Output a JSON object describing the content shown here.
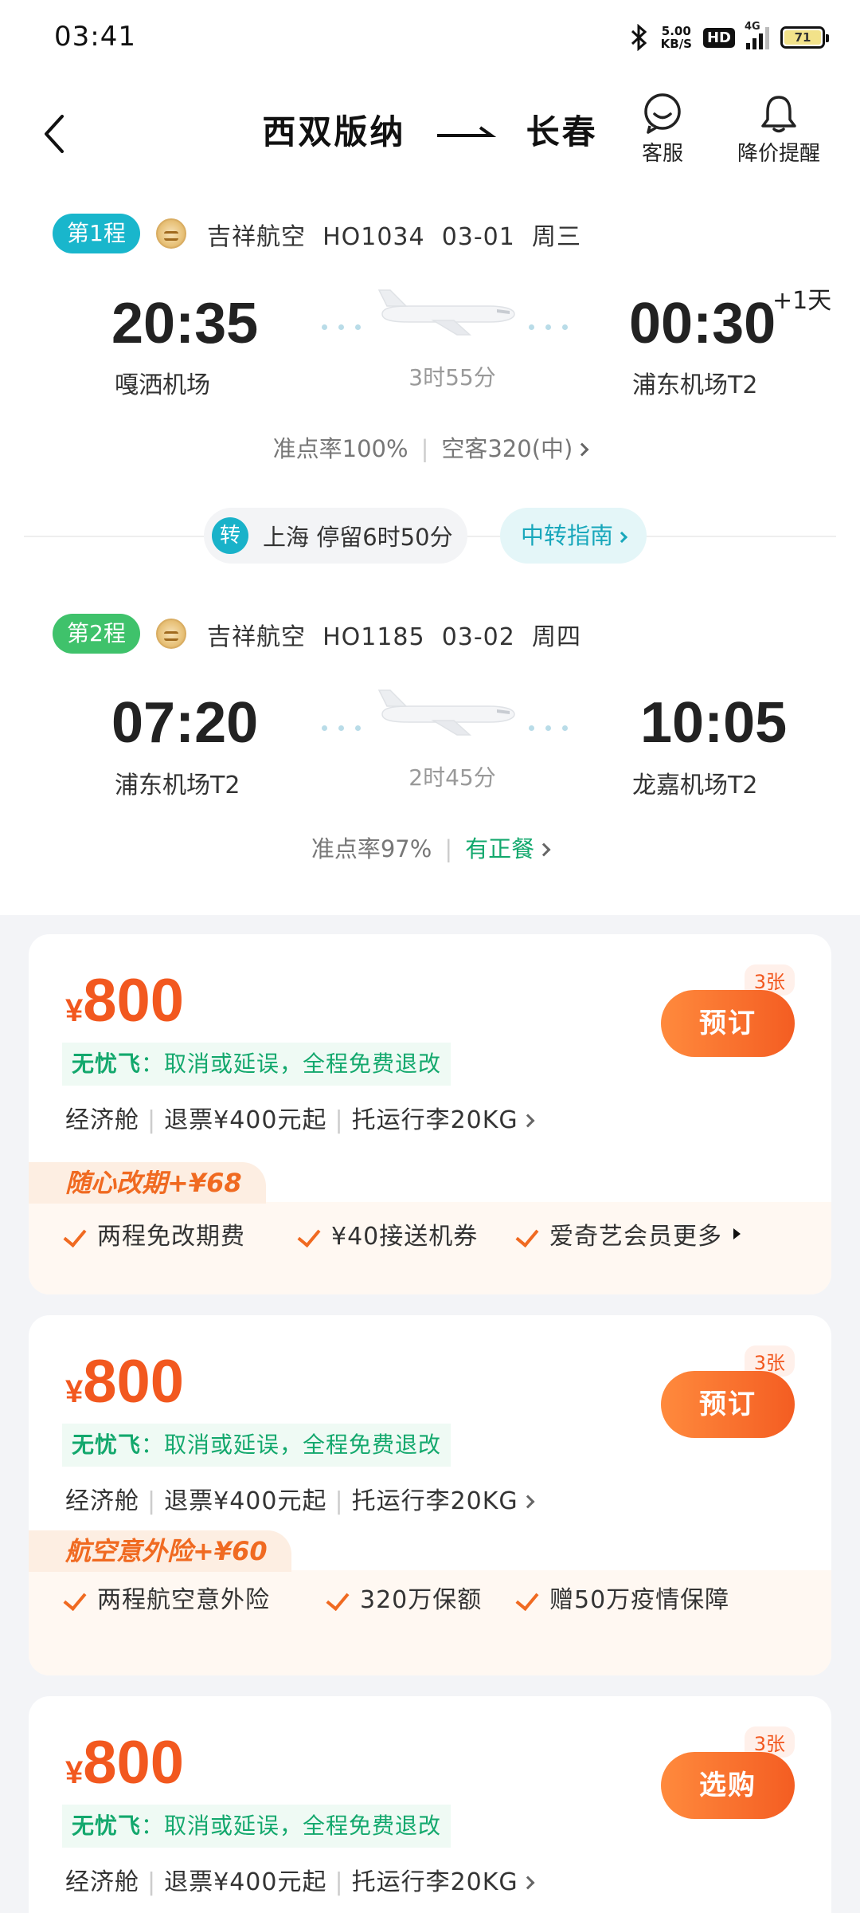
{
  "status_bar": {
    "time": "03:41",
    "net_speed": "5.00",
    "net_unit": "KB/S",
    "hd_label": "HD",
    "signal_label": "4G",
    "battery": "71"
  },
  "header": {
    "origin": "西双版纳",
    "destination": "长春",
    "service_label": "客服",
    "alert_label": "降价提醒"
  },
  "legs": [
    {
      "badge": "第1程",
      "badge_color": "#19b6cc",
      "airline": "吉祥航空",
      "flight_no": "HO1034",
      "date": "03-01",
      "weekday": "周三",
      "dep_time": "20:35",
      "dep_airport": "嘎洒机场",
      "arr_time": "00:30",
      "arr_airport": "浦东机场T2",
      "day_offset": "+1天",
      "duration": "3时55分",
      "ontime": "准点率100%",
      "extra": "空客320(中)"
    },
    {
      "badge": "第2程",
      "badge_color": "#3fc26b",
      "airline": "吉祥航空",
      "flight_no": "HO1185",
      "date": "03-02",
      "weekday": "周四",
      "dep_time": "07:20",
      "dep_airport": "浦东机场T2",
      "arr_time": "10:05",
      "arr_airport": "龙嘉机场T2",
      "duration": "2时45分",
      "ontime": "准点率97%",
      "extra": "有正餐"
    }
  ],
  "transfer": {
    "icon_label": "转",
    "text": "上海 停留6时50分",
    "guide": "中转指南"
  },
  "fares": [
    {
      "currency": "¥",
      "price": "800",
      "wuyou_title": "无忧飞",
      "wuyou_text": "：取消或延误，全程免费退改",
      "cabin": "经济舱",
      "refund": "退票¥400元起",
      "baggage": "托运行李20KG",
      "button": "预订",
      "tickets": "3张",
      "promo_title": "随心改期+¥68",
      "features": [
        "两程免改期费",
        "¥40接送机券",
        "爱奇艺会员更多"
      ]
    },
    {
      "currency": "¥",
      "price": "800",
      "wuyou_title": "无忧飞",
      "wuyou_text": "：取消或延误，全程免费退改",
      "cabin": "经济舱",
      "refund": "退票¥400元起",
      "baggage": "托运行李20KG",
      "button": "预订",
      "tickets": "3张",
      "promo_title": "航空意外险+¥60",
      "features": [
        "两程航空意外险",
        "320万保额",
        "赠50万疫情保障"
      ]
    },
    {
      "currency": "¥",
      "price": "800",
      "wuyou_title": "无忧飞",
      "wuyou_text": "：取消或延误，全程免费退改",
      "cabin": "经济舱",
      "refund": "退票¥400元起",
      "baggage": "托运行李20KG",
      "button": "选购",
      "tickets": "3张"
    }
  ]
}
